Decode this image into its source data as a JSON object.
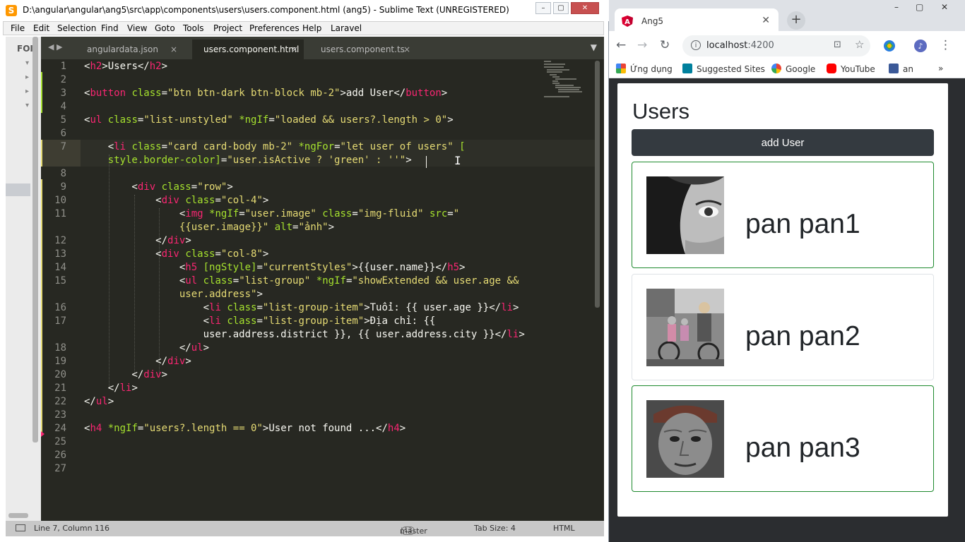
{
  "sublime": {
    "title": "D:\\angular\\angular\\ang5\\src\\app\\components\\users\\users.component.html (ang5) - Sublime Text (UNREGISTERED)",
    "logo_letter": "S",
    "window_buttons": {
      "minimize": "–",
      "maximize": "▢",
      "close": "✕"
    },
    "menu": [
      "File",
      "Edit",
      "Selection",
      "Find",
      "View",
      "Goto",
      "Tools",
      "Project",
      "Preferences",
      "Help",
      "Laravel"
    ],
    "sidebar_label": "FOI",
    "tabs": [
      {
        "label": "angulardata.json",
        "active": false
      },
      {
        "label": "users.component.html",
        "active": true
      },
      {
        "label": "users.component.ts",
        "active": false
      }
    ],
    "tab_close": "×",
    "line_numbers": [
      "1",
      "2",
      "3",
      "4",
      "5",
      "6",
      "7",
      "",
      "8",
      "9",
      "10",
      "11",
      "",
      "12",
      "13",
      "14",
      "15",
      "",
      "16",
      "17",
      "",
      "18",
      "19",
      "20",
      "21",
      "22",
      "23",
      "24",
      "25",
      "26",
      "27"
    ],
    "status": {
      "position": "Line 7, Column 116",
      "branch": "master",
      "branch_count": "13",
      "tab_size": "Tab Size: 4",
      "syntax": "HTML"
    }
  },
  "chrome": {
    "tab_title": "Ang5",
    "tab_close": "✕",
    "new_tab": "+",
    "window_buttons": {
      "minimize": "–",
      "maximize": "▢",
      "close": "✕"
    },
    "url_host": "localhost",
    "url_port": ":4200",
    "bookmarks": [
      "Ứng dụng",
      "Suggested Sites",
      "Google",
      "YouTube",
      "an"
    ],
    "bookmarks_more": "»",
    "page": {
      "title": "Users",
      "add_button": "add User",
      "users": [
        {
          "name": "pan pan1",
          "active": true,
          "photo": "woman-closeup-photo"
        },
        {
          "name": "pan pan2",
          "active": false,
          "photo": "street-bicycle-photo"
        },
        {
          "name": "pan pan3",
          "active": true,
          "photo": "old-man-photo"
        }
      ]
    },
    "colors": {
      "active_border": "#1e8a2e",
      "button_bg": "#343a40"
    }
  }
}
